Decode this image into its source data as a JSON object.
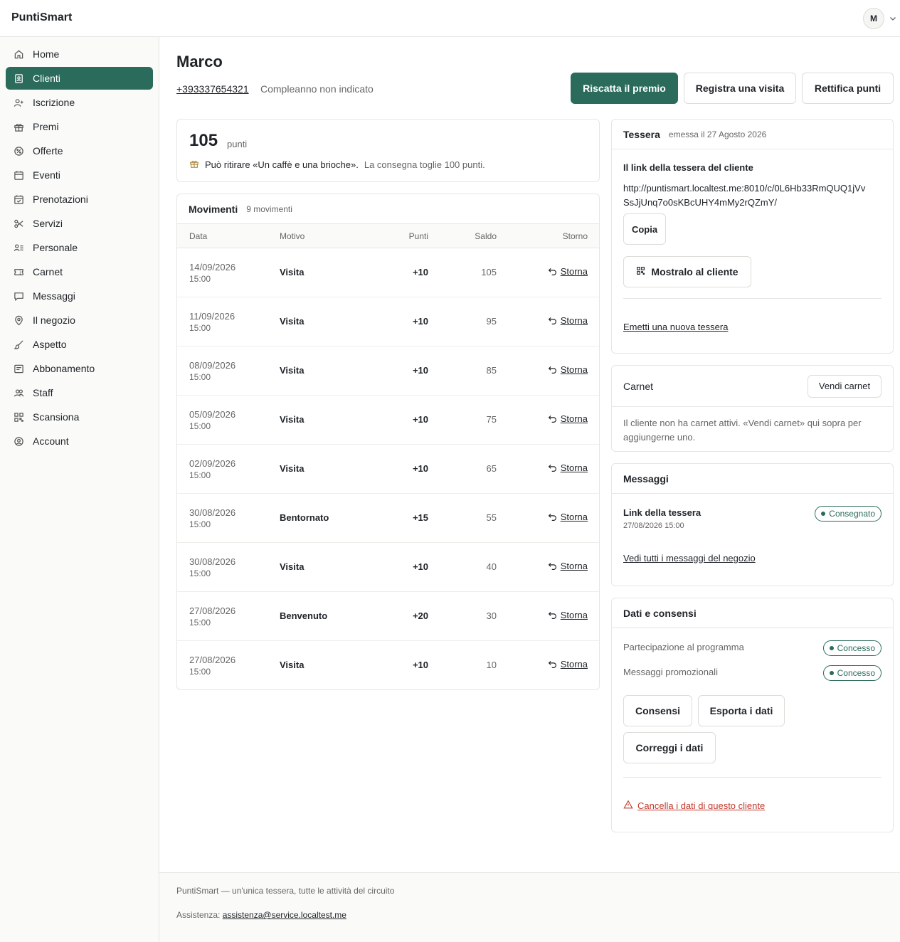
{
  "app": {
    "brand": "PuntiSmart",
    "user_initial": "M"
  },
  "sidebar": {
    "items": [
      {
        "label": "Home",
        "icon": "home-icon"
      },
      {
        "label": "Clienti",
        "icon": "contacts-icon",
        "active": true
      },
      {
        "label": "Iscrizione",
        "icon": "user-plus-icon"
      },
      {
        "label": "Premi",
        "icon": "gift-icon"
      },
      {
        "label": "Offerte",
        "icon": "percent-badge-icon"
      },
      {
        "label": "Eventi",
        "icon": "calendar-icon"
      },
      {
        "label": "Prenotazioni",
        "icon": "calendar-check-icon"
      },
      {
        "label": "Servizi",
        "icon": "scissors-icon"
      },
      {
        "label": "Personale",
        "icon": "user-list-icon"
      },
      {
        "label": "Carnet",
        "icon": "ticket-icon"
      },
      {
        "label": "Messaggi",
        "icon": "message-icon"
      },
      {
        "label": "Il negozio",
        "icon": "map-pin-icon"
      },
      {
        "label": "Aspetto",
        "icon": "brush-icon"
      },
      {
        "label": "Abbonamento",
        "icon": "receipt-icon"
      },
      {
        "label": "Staff",
        "icon": "users-icon"
      },
      {
        "label": "Scansiona",
        "icon": "qr-code-icon"
      },
      {
        "label": "Account",
        "icon": "user-circle-icon"
      }
    ]
  },
  "customer": {
    "name": "Marco",
    "phone": "+393337654321",
    "birthday": "Compleanno non indicato"
  },
  "actions": {
    "redeem": "Riscatta il premio",
    "visit": "Registra una visita",
    "adjust": "Rettifica punti"
  },
  "points": {
    "value": "105",
    "unit": "punti",
    "reward_main": "Può ritirare «Un caffè e una brioche».",
    "reward_note": "La consegna toglie 100 punti."
  },
  "movements": {
    "title": "Movimenti",
    "count": "9 movimenti",
    "columns": {
      "date": "Data",
      "reason": "Motivo",
      "points": "Punti",
      "balance": "Saldo",
      "undo": "Storno"
    },
    "undo_label": "Storna",
    "rows": [
      {
        "date": "14/09/2026",
        "time": "15:00",
        "reason": "Visita",
        "points": "+10",
        "balance": "105"
      },
      {
        "date": "11/09/2026",
        "time": "15:00",
        "reason": "Visita",
        "points": "+10",
        "balance": "95"
      },
      {
        "date": "08/09/2026",
        "time": "15:00",
        "reason": "Visita",
        "points": "+10",
        "balance": "85"
      },
      {
        "date": "05/09/2026",
        "time": "15:00",
        "reason": "Visita",
        "points": "+10",
        "balance": "75"
      },
      {
        "date": "02/09/2026",
        "time": "15:00",
        "reason": "Visita",
        "points": "+10",
        "balance": "65"
      },
      {
        "date": "30/08/2026",
        "time": "15:00",
        "reason": "Bentornato",
        "points": "+15",
        "balance": "55"
      },
      {
        "date": "30/08/2026",
        "time": "15:00",
        "reason": "Visita",
        "points": "+10",
        "balance": "40"
      },
      {
        "date": "27/08/2026",
        "time": "15:00",
        "reason": "Benvenuto",
        "points": "+20",
        "balance": "30"
      },
      {
        "date": "27/08/2026",
        "time": "15:00",
        "reason": "Visita",
        "points": "+10",
        "balance": "10"
      }
    ]
  },
  "card": {
    "title": "Tessera",
    "issued": "emessa il 27 Agosto 2026",
    "link_label": "Il link della tessera del cliente",
    "link_line1": "http://puntismart.localtest.me:8010/c/0L6Hb33RmQUQ1jVv",
    "link_line2": "SsJjUnq7o0sKBcUHY4mMy2rQZmY/",
    "copy": "Copia",
    "show": "Mostralo al cliente",
    "new_card": "Emetti una nuova tessera"
  },
  "carnet": {
    "title": "Carnet",
    "sell": "Vendi carnet",
    "empty_line1": "Il cliente non ha carnet attivi. «Vendi carnet» qui sopra per",
    "empty_line2": "aggiungerne uno."
  },
  "messages": {
    "title": "Messaggi",
    "item_title": "Link della tessera",
    "item_time": "27/08/2026 15:00",
    "item_status": "Consegnato",
    "all_link": "Vedi tutti i messaggi del negozio"
  },
  "consents": {
    "title": "Dati e consensi",
    "program_label": "Partecipazione al programma",
    "program_status": "Concesso",
    "promo_label": "Messaggi promozionali",
    "promo_status": "Concesso",
    "btn_consents": "Consensi",
    "btn_export": "Esporta i dati",
    "btn_fix": "Correggi i dati",
    "delete": "Cancella i dati di questo cliente"
  },
  "footer": {
    "tagline": "PuntiSmart — un'unica tessera, tutte le attività del circuito",
    "support_label": "Assistenza:",
    "support_email": "assistenza@service.localtest.me"
  },
  "colors": {
    "accent": "#2b6b5b",
    "danger": "#c0392b",
    "gift": "#b08a3e"
  }
}
